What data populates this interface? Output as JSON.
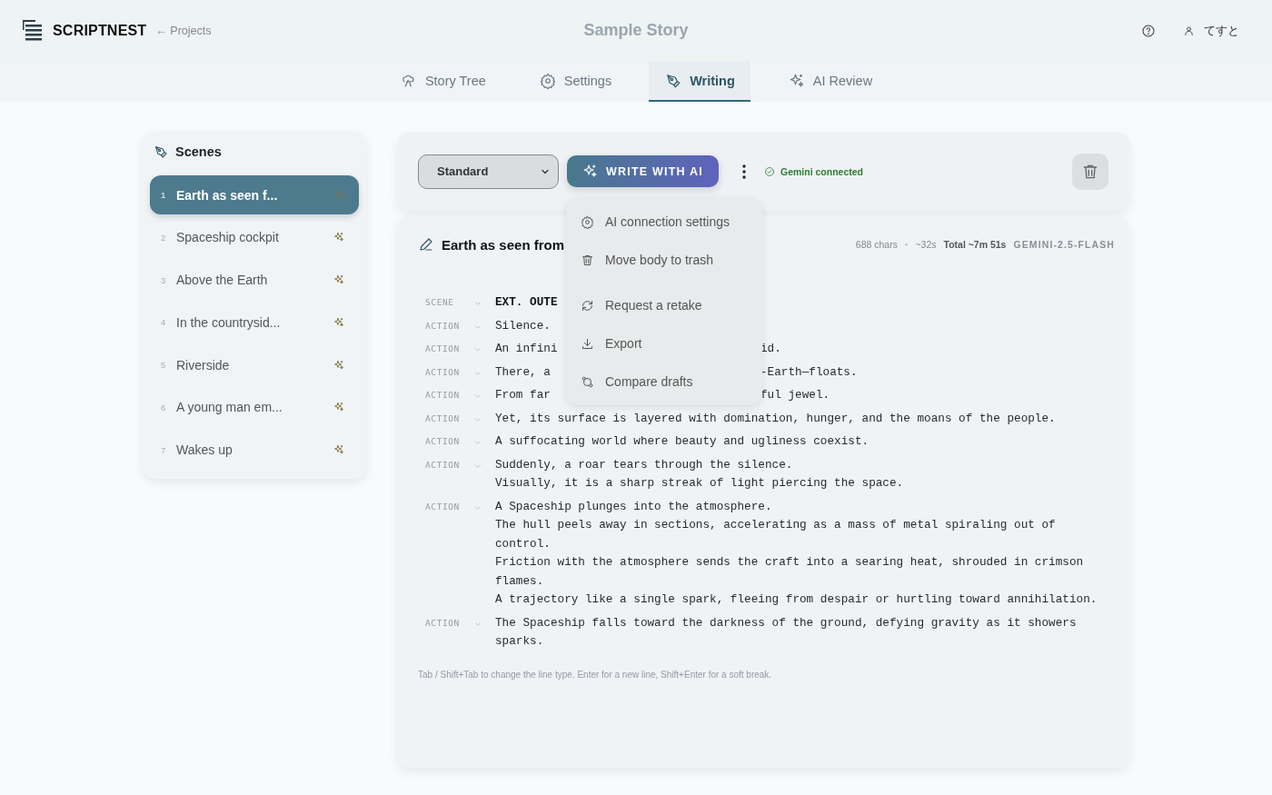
{
  "app": {
    "name": "SCRIPTNEST",
    "back_link": "← Projects",
    "title": "Sample Story",
    "user": "てすと"
  },
  "tabs": [
    {
      "label": "Story Tree",
      "selected": false
    },
    {
      "label": "Settings",
      "selected": false
    },
    {
      "label": "Writing",
      "selected": true
    },
    {
      "label": "AI Review",
      "selected": false
    }
  ],
  "scenes": {
    "title": "Scenes",
    "items": [
      {
        "number": "1",
        "title": "Earth as seen f...",
        "selected": true
      },
      {
        "number": "2",
        "title": "Spaceship cockpit",
        "selected": false
      },
      {
        "number": "3",
        "title": "Above the Earth",
        "selected": false
      },
      {
        "number": "4",
        "title": "In the countrysid...",
        "selected": false
      },
      {
        "number": "5",
        "title": "Riverside",
        "selected": false
      },
      {
        "number": "6",
        "title": "A young man em...",
        "selected": false
      },
      {
        "number": "7",
        "title": "Wakes up",
        "selected": false
      }
    ]
  },
  "toolbar": {
    "mode": "Standard",
    "write_button": "WRITE WITH AI",
    "status": "Gemini connected"
  },
  "menu": {
    "groups": [
      [
        {
          "label": "AI connection settings"
        },
        {
          "label": "Move body to trash"
        }
      ],
      [
        {
          "label": "Request a retake"
        },
        {
          "label": "Export"
        },
        {
          "label": "Compare drafts"
        }
      ]
    ]
  },
  "editor": {
    "title": "Earth as seen from",
    "stats": [
      {
        "text": "688 chars",
        "kind": "plain"
      },
      {
        "text": "·",
        "kind": "separator"
      },
      {
        "text": "~32s",
        "kind": "plain"
      },
      {
        "text": "Total ~7m 51s",
        "kind": "strong"
      },
      {
        "text": "GEMINI-2.5-FLASH",
        "kind": "model"
      }
    ],
    "rows": [
      {
        "kind": "scene",
        "label": "SCENE",
        "lines": [
          [
            "EXT. OUTE"
          ]
        ]
      },
      {
        "kind": "action",
        "label": "ACTION",
        "lines": [
          [
            "Silence."
          ]
        ]
      },
      {
        "kind": "action",
        "label": "ACTION",
        "lines": [
          [
            "An infini",
            "id."
          ]
        ]
      },
      {
        "kind": "action",
        "label": "ACTION",
        "lines": [
          [
            "There, a",
            "-Earth—floats."
          ]
        ]
      },
      {
        "kind": "action",
        "label": "ACTION",
        "lines": [
          [
            "From far",
            "ful jewel."
          ]
        ]
      },
      {
        "kind": "action",
        "label": "ACTION",
        "lines": [
          [
            "Yet, its surface is layered with domination, hunger, and the moans of the people."
          ]
        ]
      },
      {
        "kind": "action",
        "label": "ACTION",
        "lines": [
          [
            "A suffocating world where beauty and ugliness coexist."
          ]
        ]
      },
      {
        "kind": "action",
        "label": "ACTION",
        "lines": [
          [
            "Suddenly, a roar tears through the silence."
          ],
          [
            "Visually, it is a sharp streak of light piercing the space."
          ]
        ]
      },
      {
        "kind": "action",
        "label": "ACTION",
        "lines": [
          [
            "A Spaceship plunges into the atmosphere."
          ],
          [
            "The hull peels away in sections, accelerating as a mass of metal spiraling out of control."
          ],
          [
            "Friction with the atmosphere sends the craft into a searing heat, shrouded in crimson flames."
          ],
          [
            "A trajectory like a single spark, fleeing from despair or hurtling toward annihilation."
          ]
        ]
      },
      {
        "kind": "action",
        "label": "ACTION",
        "lines": [
          [
            "The Spaceship falls toward the darkness of the ground, defying gravity as it showers sparks."
          ]
        ]
      }
    ],
    "hint": "Tab / Shift+Tab to change the line type. Enter for a new line, Shift+Enter for a soft break."
  }
}
